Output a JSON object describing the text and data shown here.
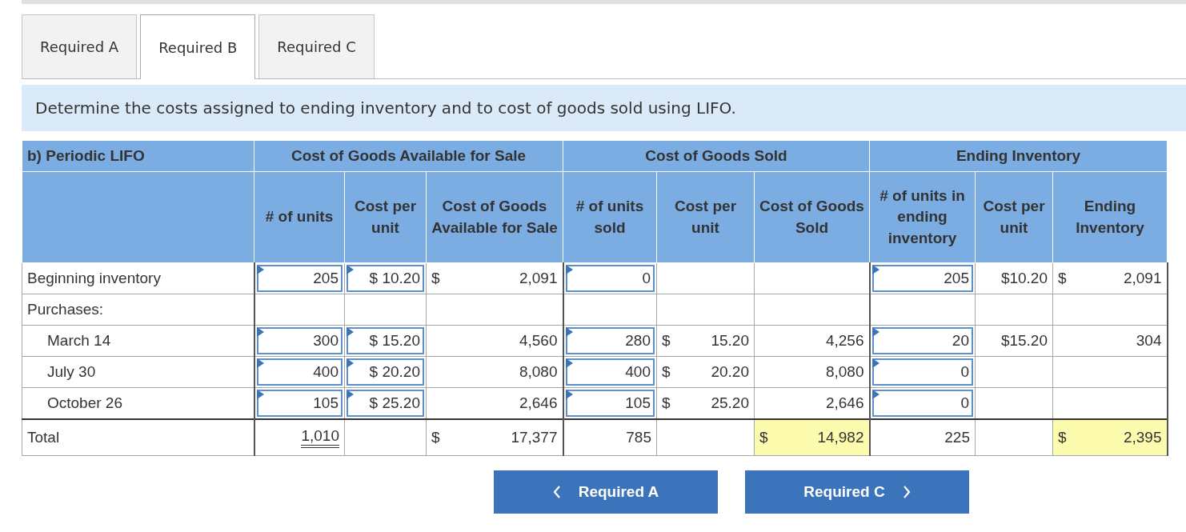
{
  "tabs": [
    {
      "label": "Required A",
      "selected": false
    },
    {
      "label": "Required B",
      "selected": true
    },
    {
      "label": "Required C",
      "selected": false
    }
  ],
  "instruction": "Determine the costs assigned to ending inventory and to cost of goods sold using LIFO.",
  "table": {
    "title": "b) Periodic LIFO",
    "groups": [
      {
        "label": "Cost of Goods Available for Sale"
      },
      {
        "label": "Cost of Goods Sold"
      },
      {
        "label": "Ending Inventory"
      }
    ],
    "columns": [
      "# of units",
      "Cost per unit",
      "Cost of Goods Available for Sale",
      "# of units sold",
      "Cost per unit",
      "Cost of Goods Sold",
      "# of units in ending inventory",
      "Cost per unit",
      "Ending Inventory"
    ],
    "rows": [
      {
        "label": "Beginning inventory",
        "cells": [
          {
            "kind": "input",
            "value": "205"
          },
          {
            "kind": "input",
            "value": "$ 10.20"
          },
          {
            "kind": "text",
            "currency": "$",
            "value": "2,091"
          },
          {
            "kind": "input",
            "value": "0"
          },
          {
            "kind": "blank"
          },
          {
            "kind": "blank"
          },
          {
            "kind": "input",
            "value": "205"
          },
          {
            "kind": "text",
            "value": "$10.20"
          },
          {
            "kind": "text",
            "currency": "$",
            "value": "2,091"
          }
        ]
      },
      {
        "label": "Purchases:",
        "cells": [
          {
            "kind": "blank"
          },
          {
            "kind": "blank"
          },
          {
            "kind": "blank"
          },
          {
            "kind": "blank"
          },
          {
            "kind": "blank"
          },
          {
            "kind": "blank"
          },
          {
            "kind": "blank"
          },
          {
            "kind": "blank"
          },
          {
            "kind": "blank"
          }
        ],
        "children": [
          {
            "label": "March 14",
            "cells": [
              {
                "kind": "input",
                "value": "300"
              },
              {
                "kind": "input",
                "value": "$ 15.20"
              },
              {
                "kind": "text",
                "value": "4,560"
              },
              {
                "kind": "input",
                "value": "280"
              },
              {
                "kind": "text",
                "currency": "$",
                "value": "15.20"
              },
              {
                "kind": "text",
                "value": "4,256"
              },
              {
                "kind": "input",
                "value": "20"
              },
              {
                "kind": "text",
                "value": "$15.20"
              },
              {
                "kind": "text",
                "value": "304"
              }
            ]
          },
          {
            "label": "July 30",
            "cells": [
              {
                "kind": "input",
                "value": "400"
              },
              {
                "kind": "input",
                "value": "$ 20.20"
              },
              {
                "kind": "text",
                "value": "8,080"
              },
              {
                "kind": "input",
                "value": "400"
              },
              {
                "kind": "text",
                "currency": "$",
                "value": "20.20"
              },
              {
                "kind": "text",
                "value": "8,080"
              },
              {
                "kind": "input",
                "value": "0"
              },
              {
                "kind": "blank"
              },
              {
                "kind": "blank"
              }
            ]
          },
          {
            "label": "October 26",
            "cells": [
              {
                "kind": "input",
                "value": "105"
              },
              {
                "kind": "input",
                "value": "$ 25.20"
              },
              {
                "kind": "text",
                "value": "2,646"
              },
              {
                "kind": "input",
                "value": "105"
              },
              {
                "kind": "text",
                "currency": "$",
                "value": "25.20"
              },
              {
                "kind": "text",
                "value": "2,646"
              },
              {
                "kind": "input",
                "value": "0"
              },
              {
                "kind": "blank"
              },
              {
                "kind": "blank"
              }
            ]
          }
        ]
      },
      {
        "label": "Total",
        "total": true,
        "cells": [
          {
            "kind": "text",
            "value": "1,010",
            "double_underline": true
          },
          {
            "kind": "blank"
          },
          {
            "kind": "text",
            "currency": "$",
            "value": "17,377"
          },
          {
            "kind": "text",
            "value": "785"
          },
          {
            "kind": "blank"
          },
          {
            "kind": "text",
            "currency": "$",
            "value": "14,982",
            "highlighted": true
          },
          {
            "kind": "text",
            "value": "225"
          },
          {
            "kind": "blank"
          },
          {
            "kind": "text",
            "currency": "$",
            "value": "2,395",
            "highlighted": true
          }
        ]
      }
    ]
  },
  "nav_buttons": [
    {
      "label": "Required A",
      "kind": "prev"
    },
    {
      "label": "Required C",
      "kind": "next"
    }
  ]
}
